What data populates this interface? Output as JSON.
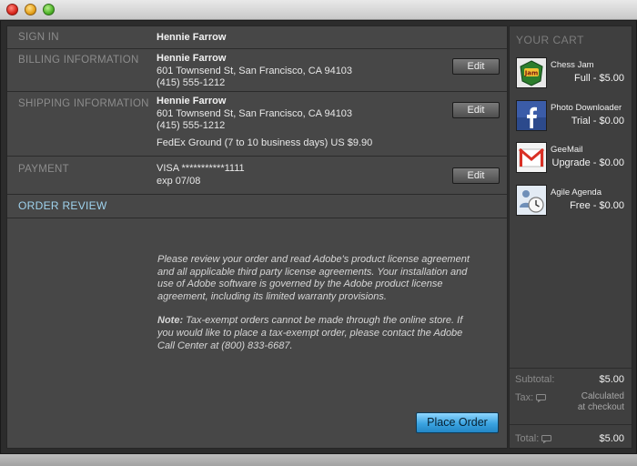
{
  "window": {
    "title": ""
  },
  "sections": {
    "sign_in": {
      "label": "SIGN IN",
      "name": "Hennie Farrow"
    },
    "billing": {
      "label": "BILLING INFORMATION",
      "name": "Hennie Farrow",
      "address": "601 Townsend St,  San Francisco, CA 94103",
      "phone": "(415) 555-1212",
      "edit_label": "Edit"
    },
    "shipping": {
      "label": "SHIPPING INFORMATION",
      "name": "Hennie Farrow",
      "address": "601 Townsend St,  San Francisco, CA 94103",
      "phone": "(415) 555-1212",
      "method": "FedEx Ground (7 to 10 business days) US $9.90",
      "edit_label": "Edit"
    },
    "payment": {
      "label": "PAYMENT",
      "card": "VISA ***********1111",
      "expiry": "exp 07/08",
      "edit_label": "Edit"
    },
    "order_review": {
      "label": "ORDER REVIEW",
      "paragraph": "Please review your order and read Adobe's product license agreement and all applicable third party license agreements. Your installation and use of Adobe software is governed by the Adobe product license agreement, including its limited warranty provisions.",
      "note_label": "Note:",
      "note_text": " Tax-exempt orders cannot be made through the online store. If you would like to place a tax-exempt order, please contact the Adobe Call Center at (800) 833-6687.",
      "place_order_label": "Place Order"
    }
  },
  "cart": {
    "title": "YOUR CART",
    "items": [
      {
        "name": "Chess Jam",
        "price": "Full  - $5.00",
        "icon": "chess-jam-icon"
      },
      {
        "name": "Photo Downloader",
        "price": "Trial - $0.00",
        "icon": "facebook-icon"
      },
      {
        "name": "GeeMail",
        "price": "Upgrade - $0.00",
        "icon": "gmail-icon"
      },
      {
        "name": "Agile Agenda",
        "price": "Free  - $0.00",
        "icon": "agenda-icon"
      }
    ],
    "subtotal_label": "Subtotal:",
    "subtotal_value": "$5.00",
    "tax_label": "Tax:",
    "tax_value_line1": "Calculated",
    "tax_value_line2": "at checkout",
    "total_label": "Total:",
    "total_value": "$5.00"
  },
  "colors": {
    "accent": "#9fd3ee",
    "panel": "#474747",
    "button_primary": "#3aa3e0"
  }
}
